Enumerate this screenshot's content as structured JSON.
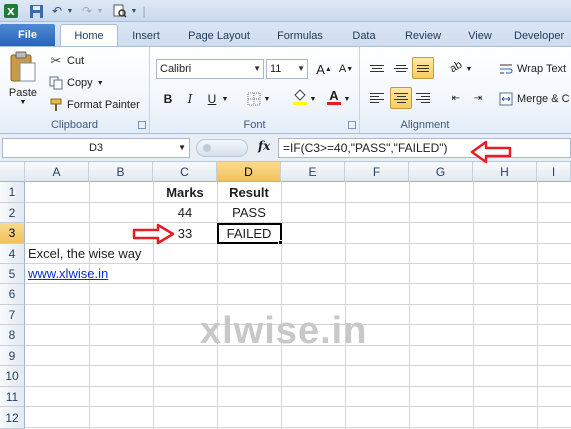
{
  "ribbon_tabs": [
    "File",
    "Home",
    "Insert",
    "Page Layout",
    "Formulas",
    "Data",
    "Review",
    "View",
    "Developer"
  ],
  "clipboard": {
    "paste_label": "Paste",
    "cut_label": "Cut",
    "copy_label": "Copy",
    "format_painter_label": "Format Painter",
    "group_label": "Clipboard"
  },
  "font": {
    "font_name": "Calibri",
    "font_size": "11",
    "bold": "B",
    "italic": "I",
    "underline": "U",
    "font_color_letter": "A",
    "group_label": "Font"
  },
  "alignment": {
    "wrap_text_label": "Wrap Text",
    "merge_label": "Merge & C",
    "group_label": "Alignment"
  },
  "formula_bar": {
    "name_box": "D3",
    "fx_label": "fx",
    "formula": "=IF(C3>=40,\"PASS\",\"FAILED\")"
  },
  "sheet": {
    "columns": [
      "A",
      "B",
      "C",
      "D",
      "E",
      "F",
      "G",
      "H",
      "I"
    ],
    "rows": [
      "1",
      "2",
      "3",
      "4",
      "5",
      "6",
      "7",
      "8",
      "9",
      "10",
      "11",
      "12"
    ],
    "selected_column": "D",
    "selected_row": "3",
    "cells": {
      "C1": "Marks",
      "D1": "Result",
      "C2": "44",
      "D2": "PASS",
      "C3": "33",
      "D3": "FAILED",
      "A4": "Excel, the wise way",
      "A5": "www.xlwise.in"
    }
  },
  "watermark": "xlwise.in",
  "colors": {
    "annotation_arrow": "#e31e24",
    "selection_header": "#f5c65e",
    "link": "#0b2bd6"
  }
}
